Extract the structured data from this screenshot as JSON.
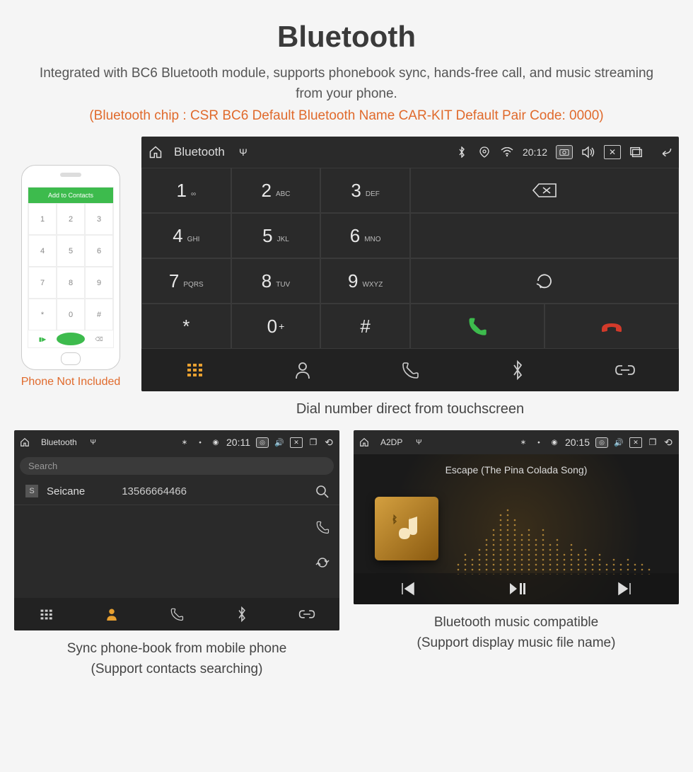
{
  "heading": "Bluetooth",
  "subheading": "Integrated with BC6 Bluetooth module, supports phonebook sync, hands-free call, and music streaming from your phone.",
  "spec_line": "(Bluetooth chip : CSR BC6     Default Bluetooth Name CAR-KIT     Default Pair Code: 0000)",
  "phone": {
    "top_label": "Add to Contacts",
    "keys": [
      "1",
      "2",
      "3",
      "4",
      "5",
      "6",
      "7",
      "8",
      "9",
      "*",
      "0",
      "#"
    ],
    "caption": "Phone Not Included"
  },
  "main_unit": {
    "title": "Bluetooth",
    "time": "20:12",
    "keys": [
      {
        "d": "1",
        "s": "∞"
      },
      {
        "d": "2",
        "s": "ABC"
      },
      {
        "d": "3",
        "s": "DEF"
      },
      {
        "d": "4",
        "s": "GHI"
      },
      {
        "d": "5",
        "s": "JKL"
      },
      {
        "d": "6",
        "s": "MNO"
      },
      {
        "d": "7",
        "s": "PQRS"
      },
      {
        "d": "8",
        "s": "TUV"
      },
      {
        "d": "9",
        "s": "WXYZ"
      },
      {
        "d": "*",
        "s": ""
      },
      {
        "d": "0",
        "s": "+",
        "sup": true
      },
      {
        "d": "#",
        "s": ""
      }
    ],
    "caption": "Dial number direct from touchscreen"
  },
  "phonebook_unit": {
    "title": "Bluetooth",
    "time": "20:11",
    "search_placeholder": "Search",
    "contact_tag": "S",
    "contact_name": "Seicane",
    "contact_number": "13566664466",
    "caption_l1": "Sync phone-book from mobile phone",
    "caption_l2": "(Support contacts searching)"
  },
  "a2dp_unit": {
    "title": "A2DP",
    "time": "20:15",
    "song": "Escape (The Pina Colada Song)",
    "caption_l1": "Bluetooth music compatible",
    "caption_l2": "(Support display music file name)"
  }
}
